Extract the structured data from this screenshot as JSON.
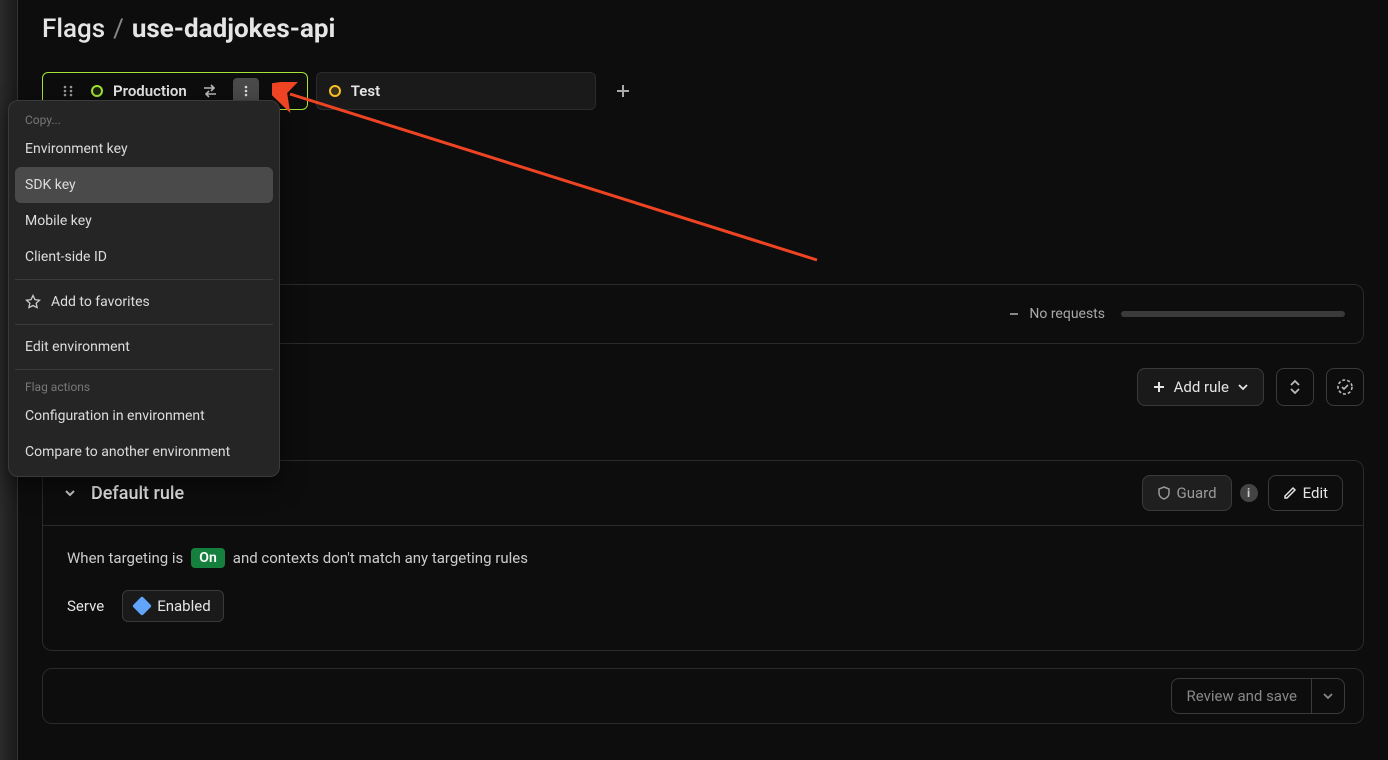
{
  "breadcrumb": {
    "parent": "Flags",
    "separator": "/",
    "current": "use-dadjokes-api"
  },
  "tabs": {
    "active": {
      "label": "Production"
    },
    "inactive": {
      "label": "Test"
    }
  },
  "dropdown": {
    "copy_label": "Copy...",
    "items": {
      "env_key": "Environment key",
      "sdk_key": "SDK key",
      "mobile_key": "Mobile key",
      "client_side_id": "Client-side ID",
      "add_favorites": "Add to favorites",
      "edit_env": "Edit environment",
      "flag_actions_label": "Flag actions",
      "config_env": "Configuration in environment",
      "compare_env": "Compare to another environment"
    }
  },
  "requests": {
    "label": "No requests"
  },
  "toolbar": {
    "add_rule": "Add rule"
  },
  "rule": {
    "title": "Default rule",
    "guard": "Guard",
    "edit": "Edit",
    "sentence_pre": "When targeting is",
    "on": "On",
    "sentence_post": "and contexts don't match any targeting rules",
    "serve_label": "Serve",
    "serve_value": "Enabled"
  },
  "review": {
    "label": "Review and save"
  }
}
